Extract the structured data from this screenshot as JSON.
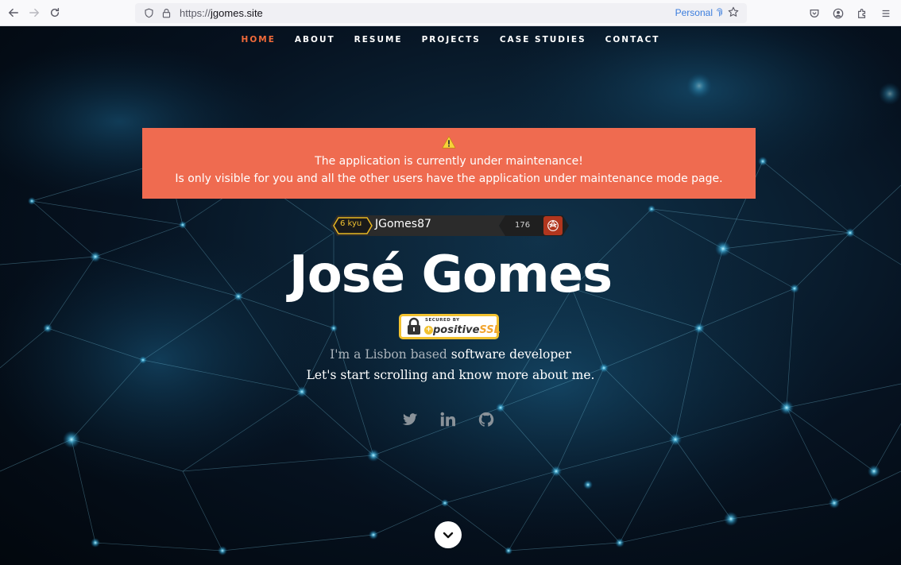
{
  "browser": {
    "url_protocol": "https://",
    "url_host": "jgomes.site",
    "container_label": "Personal",
    "icons": [
      "back-icon",
      "forward-icon",
      "reload-icon",
      "shield-icon",
      "lock-icon",
      "star-icon",
      "pocket-icon",
      "account-icon",
      "extensions-icon",
      "menu-icon"
    ]
  },
  "nav": {
    "items": [
      {
        "label": "HOME",
        "active": true
      },
      {
        "label": "ABOUT",
        "active": false
      },
      {
        "label": "RESUME",
        "active": false
      },
      {
        "label": "PROJECTS",
        "active": false
      },
      {
        "label": "CASE STUDIES",
        "active": false
      },
      {
        "label": "CONTACT",
        "active": false
      }
    ],
    "active_color": "#f06a3a"
  },
  "alert": {
    "line1": "The application is currently under maintenance!",
    "line2": "Is only visible for you and all the other users have the application under maintenance mode page.",
    "background": "#ef6b50"
  },
  "codewars": {
    "rank": "6 kyu",
    "username": "JGomes87",
    "honor": "176"
  },
  "hero": {
    "name": "José Gomes",
    "tagline_muted": "I'm a Lisbon based",
    "tagline_bold": "software developer",
    "tagline_line2": "Let's start scrolling and know more about me."
  },
  "ssl_badge": {
    "small": "SECURED BY",
    "brand_prefix": "positive",
    "brand_suffix": "SSL"
  },
  "socials": [
    "twitter-icon",
    "linkedin-icon",
    "github-icon"
  ]
}
